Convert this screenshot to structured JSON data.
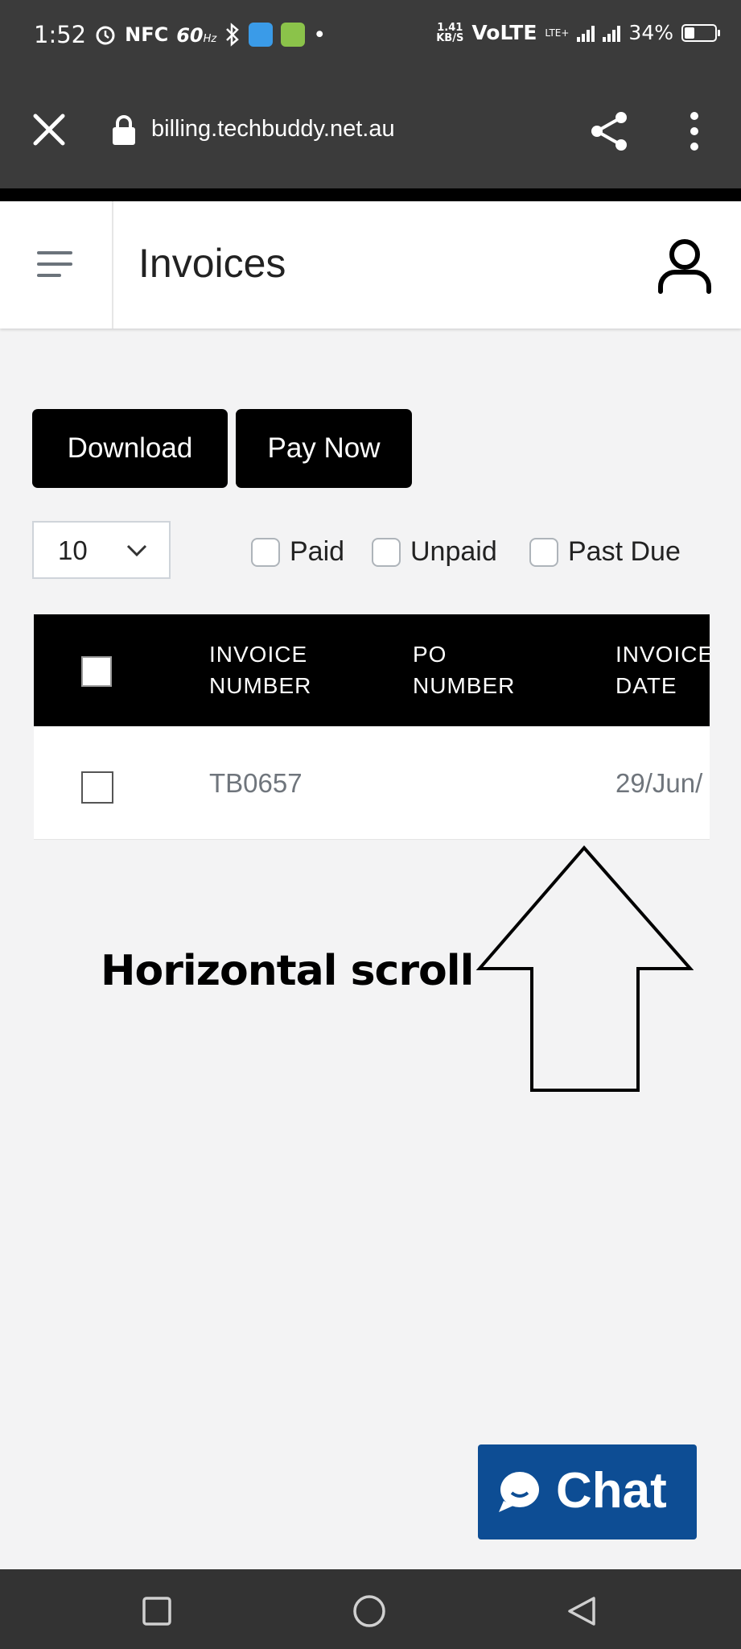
{
  "status_bar": {
    "time": "1:52",
    "nfc": "NFC",
    "refresh": "60",
    "refresh_unit": "Hz",
    "dot": "•",
    "speed_value": "1.41",
    "speed_unit": "KB/S",
    "volte": "VoLTE",
    "lte": "LTE+",
    "battery": "34%",
    "battery_level": 0.34
  },
  "browser": {
    "url": "billing.techbuddy.net.au",
    "icons": [
      "close-icon",
      "lock-icon",
      "share-icon",
      "more-vert-icon"
    ]
  },
  "header": {
    "title": "Invoices",
    "icons": [
      "hamburger-icon",
      "user-icon"
    ]
  },
  "actions": {
    "download_label": "Download",
    "pay_now_label": "Pay Now"
  },
  "page_size": {
    "selected": "10"
  },
  "filters": {
    "paid": "Paid",
    "unpaid": "Unpaid",
    "past_due": "Past Due"
  },
  "table": {
    "columns": [
      "INVOICE\nNUMBER",
      "PO\nNUMBER",
      "INVOICE\nDATE"
    ],
    "rows": [
      {
        "invoice_number": "TB0657",
        "po_number": "",
        "invoice_date": "29/Jun/"
      }
    ]
  },
  "annotation": {
    "text": "Horizontal scroll"
  },
  "chat": {
    "label": "Chat",
    "color": "#0d4d94"
  },
  "nav": {
    "icons": [
      "recents-icon",
      "home-icon",
      "back-icon"
    ]
  }
}
